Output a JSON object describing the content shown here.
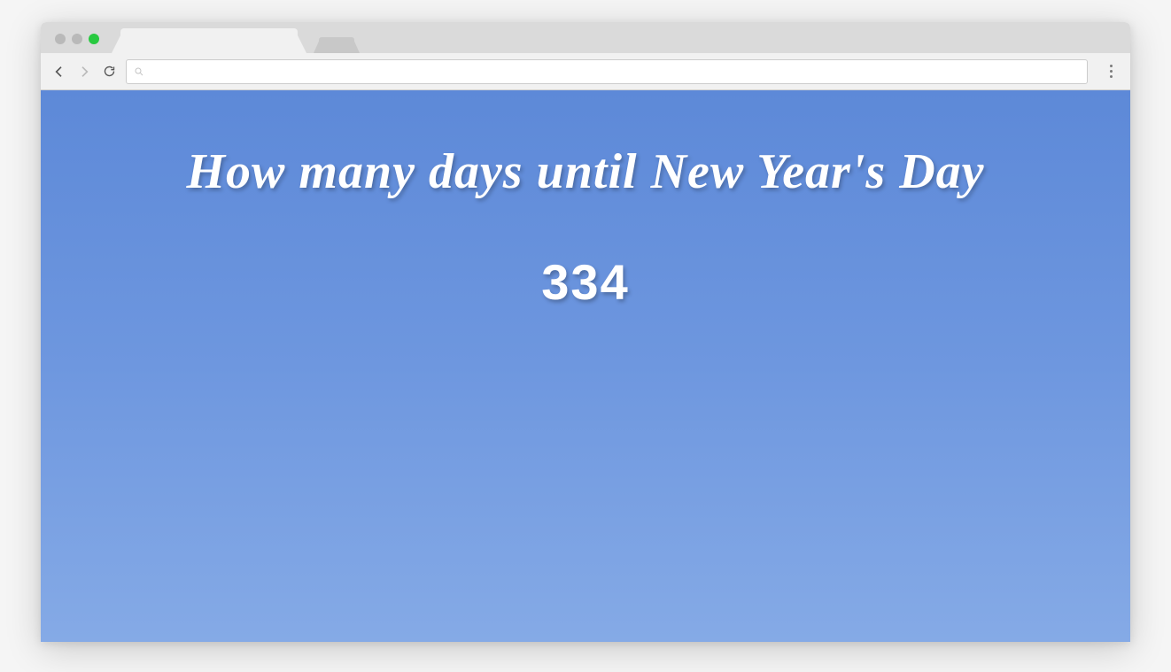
{
  "browser": {
    "address_value": ""
  },
  "page": {
    "heading": "How many days until New Year's Day",
    "count": "334"
  }
}
